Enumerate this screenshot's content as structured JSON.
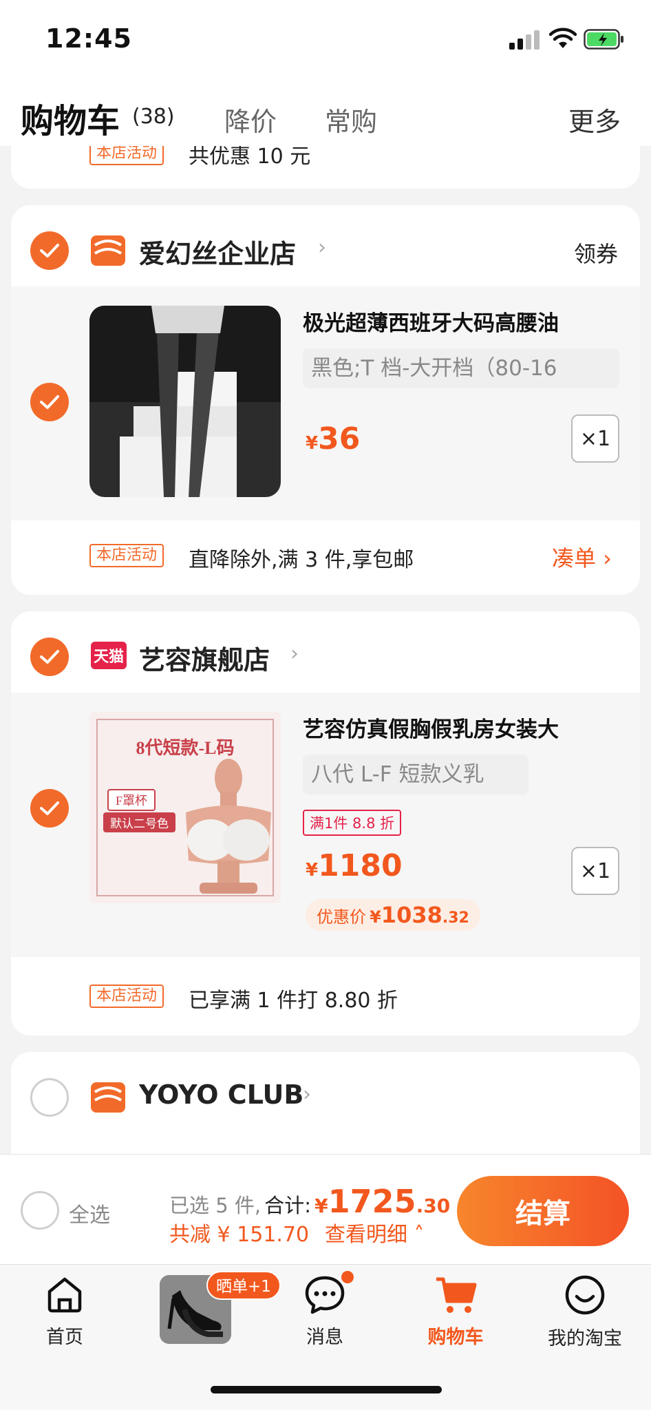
{
  "status": {
    "time": "12:45"
  },
  "header": {
    "title": "购物车",
    "count": "(38)",
    "tabs": [
      "降价",
      "常购"
    ],
    "more": "更多"
  },
  "top_card": {
    "tag": "本店活动",
    "text": "共优惠 10 元"
  },
  "stores": [
    {
      "name": "爱幻丝企业店",
      "badge_icon": "taobao-shop-icon",
      "coupon": "领券",
      "product": {
        "title": "极光超薄西班牙大码高腰油",
        "sku": "黑色;T 档-大开档（80-16",
        "price_symbol": "¥",
        "price": "36",
        "qty": "×1"
      },
      "promo_tag": "本店活动",
      "promo_text": "直降除外,满 3 件,享包邮",
      "promo_link": "凑单 ›"
    },
    {
      "name": "艺容旗舰店",
      "badge_icon": "tmall-icon",
      "badge_text": "天猫",
      "product": {
        "title": "艺容仿真假胸假乳房女装大",
        "sku": "八代 L-F 短款义乳",
        "discount_tag": "满1件 8.8 折",
        "price_symbol": "¥",
        "price": "1180",
        "qty": "×1",
        "youhui_label": "优惠价",
        "youhui_symbol": "¥",
        "youhui_int": "1038",
        "youhui_dec": ".32",
        "image_text": {
          "title": "8代短款-L码",
          "cup": "F罩杯",
          "color": "默认二号色"
        }
      },
      "promo_tag": "本店活动",
      "promo_text": "已享满 1 件打 8.80 折"
    },
    {
      "name": "YOYO CLUB",
      "badge_icon": "taobao-shop-icon"
    }
  ],
  "checkout": {
    "select_all": "全选",
    "selected": "已选 5 件,",
    "total_label": "合计:",
    "total_symbol": "¥",
    "total_int": "1725",
    "total_dec": ".30",
    "saved": "共减 ¥ 151.70",
    "detail": "查看明细 ˄",
    "button": "结算"
  },
  "tabbar": {
    "items": [
      {
        "label": "首页",
        "icon": "home-icon"
      },
      {
        "label": "",
        "icon": "shoe-thumbnail",
        "badge": "晒单+1"
      },
      {
        "label": "消息",
        "icon": "message-icon"
      },
      {
        "label": "购物车",
        "icon": "cart-icon",
        "active": true
      },
      {
        "label": "我的淘宝",
        "icon": "profile-icon"
      }
    ]
  },
  "colors": {
    "accent": "#f26a2a",
    "price": "#f2581e",
    "tmall": "#e5224a"
  }
}
